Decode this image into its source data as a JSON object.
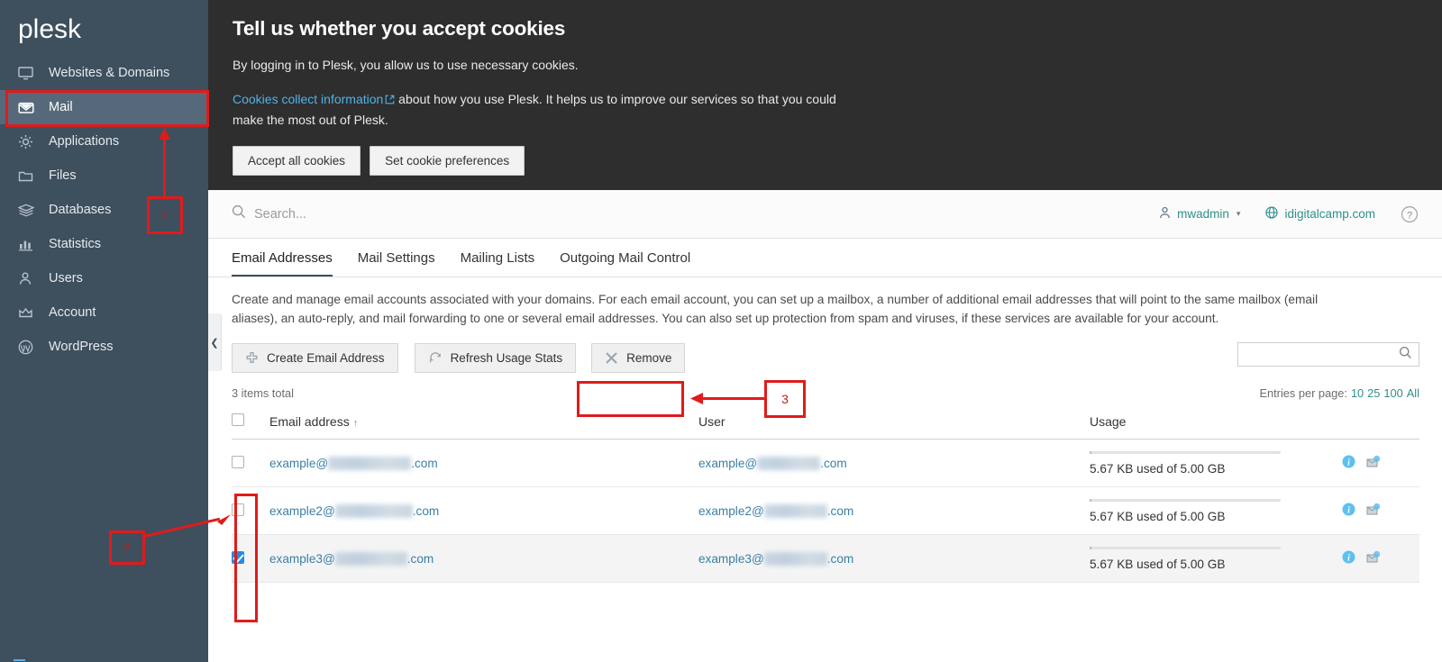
{
  "brand": {
    "name": "plesk"
  },
  "sidebar": {
    "items": [
      {
        "label": "Websites & Domains",
        "icon": "monitor-icon",
        "active": false
      },
      {
        "label": "Mail",
        "icon": "envelope-icon",
        "active": true
      },
      {
        "label": "Applications",
        "icon": "gear-icon",
        "active": false
      },
      {
        "label": "Files",
        "icon": "folder-icon",
        "active": false
      },
      {
        "label": "Databases",
        "icon": "database-stack-icon",
        "active": false
      },
      {
        "label": "Statistics",
        "icon": "bar-chart-icon",
        "active": false
      },
      {
        "label": "Users",
        "icon": "user-icon",
        "active": false
      },
      {
        "label": "Account",
        "icon": "crown-icon",
        "active": false
      },
      {
        "label": "WordPress",
        "icon": "wordpress-icon",
        "active": false
      }
    ]
  },
  "cookie_banner": {
    "title": "Tell us whether you accept cookies",
    "paragraph1": "By logging in to Plesk, you allow us to use necessary cookies.",
    "link_text": "Cookies collect information",
    "paragraph2": " about how you use Plesk. It helps us to improve our services so that you could make the most out of Plesk.",
    "accept_label": "Accept all cookies",
    "preferences_label": "Set cookie preferences",
    "link_color": "#4fb3e8",
    "background": "#2e2e2e"
  },
  "topbar": {
    "search_placeholder": "Search...",
    "user": "mwadmin",
    "domain": "idigitalcamp.com",
    "help_label": "?",
    "link_color": "#2f8f8a"
  },
  "main": {
    "tabs": [
      {
        "label": "Email Addresses",
        "active": true
      },
      {
        "label": "Mail Settings",
        "active": false
      },
      {
        "label": "Mailing Lists",
        "active": false
      },
      {
        "label": "Outgoing Mail Control",
        "active": false
      }
    ],
    "description": "Create and manage email accounts associated with your domains. For each email account, you can set up a mailbox, a number of additional email addresses that will point to the same mailbox (email aliases), an auto-reply, and mail forwarding to one or several email addresses. You can also set up protection from spam and viruses, if these services are available for your account.",
    "toolbar": [
      {
        "label": "Create Email Address",
        "icon": "plus-icon"
      },
      {
        "label": "Refresh Usage Stats",
        "icon": "refresh-icon"
      },
      {
        "label": "Remove",
        "icon": "remove-x-icon"
      }
    ],
    "list_search_value": "",
    "items_total": "3 items total",
    "entries_per_page_label": "Entries per page:",
    "entries_per_page_options": [
      "10",
      "25",
      "100",
      "All"
    ],
    "table": {
      "headers": [
        "Email address",
        "User",
        "Usage"
      ],
      "sort_column": "Email address",
      "sort_direction": "asc",
      "rows": [
        {
          "checked": false,
          "email_prefix": "example@",
          "email_suffix": ".com",
          "user_prefix": "example@",
          "user_suffix": ".com",
          "usage": "5.67 KB used of 5.00 GB",
          "actions": [
            "info-icon",
            "mail-icon"
          ]
        },
        {
          "checked": false,
          "email_prefix": "example2@",
          "email_suffix": ".com",
          "user_prefix": "example2@",
          "user_suffix": ".com",
          "usage": "5.67 KB used of 5.00 GB",
          "actions": [
            "info-icon",
            "mail-icon"
          ]
        },
        {
          "checked": true,
          "email_prefix": "example3@",
          "email_suffix": ".com",
          "user_prefix": "example3@",
          "user_suffix": ".com",
          "usage": "5.67 KB used of 5.00 GB",
          "actions": [
            "info-icon",
            "mail-icon"
          ]
        }
      ]
    }
  },
  "annotations": {
    "color": "#e01b1b",
    "markers": [
      {
        "number": "1",
        "target": "sidebar-item-mail"
      },
      {
        "number": "2",
        "target": "row-checkbox-column"
      },
      {
        "number": "3",
        "target": "remove-button"
      }
    ]
  }
}
